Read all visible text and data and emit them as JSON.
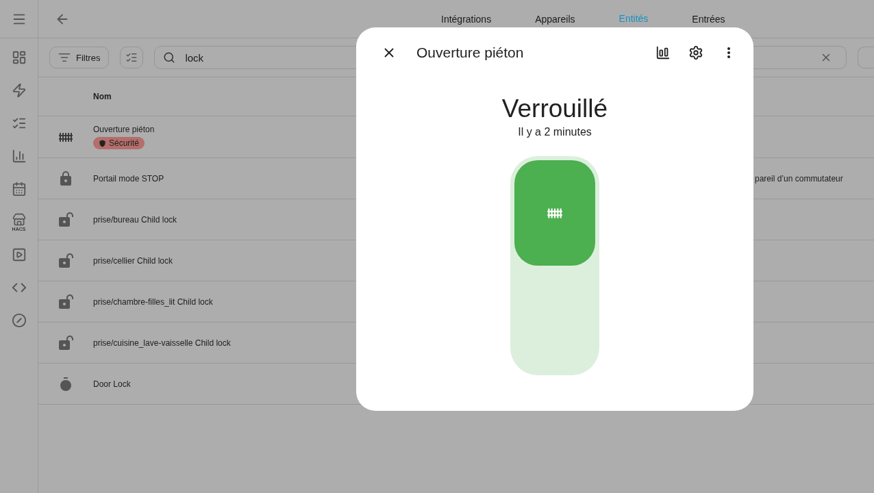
{
  "sidebar": {
    "store_label": "HACS"
  },
  "tabs": [
    {
      "label": "Intégrations",
      "selected": false
    },
    {
      "label": "Appareils",
      "selected": false
    },
    {
      "label": "Entités",
      "selected": true
    },
    {
      "label": "Entrées",
      "selected": false
    }
  ],
  "toolbar": {
    "filters_button": "Filtres",
    "search": {
      "value": "lock"
    }
  },
  "table": {
    "columns": [
      "Nom"
    ],
    "rows": [
      {
        "kind": "gate",
        "name": "Ouverture piéton",
        "badge": {
          "label": "Sécurité",
          "color": "#b46e6c"
        }
      },
      {
        "kind": "lock",
        "name": "Portail mode STOP",
        "column_3": "pareil d’un commutateur"
      },
      {
        "kind": "lock-open",
        "name": "prise/bureau Child lock"
      },
      {
        "kind": "lock-open",
        "name": "prise/cellier Child lock"
      },
      {
        "kind": "lock-open",
        "name": "prise/chambre-filles_lit Child lock"
      },
      {
        "kind": "lock-open",
        "name": "prise/cuisine_lave-vaisselle Child lock"
      },
      {
        "kind": "timer",
        "name": "Door Lock"
      }
    ]
  },
  "dialog": {
    "title": "Ouverture piéton",
    "state": "Verrouillé",
    "time": "Il y a 2 minutes",
    "locked": true
  }
}
